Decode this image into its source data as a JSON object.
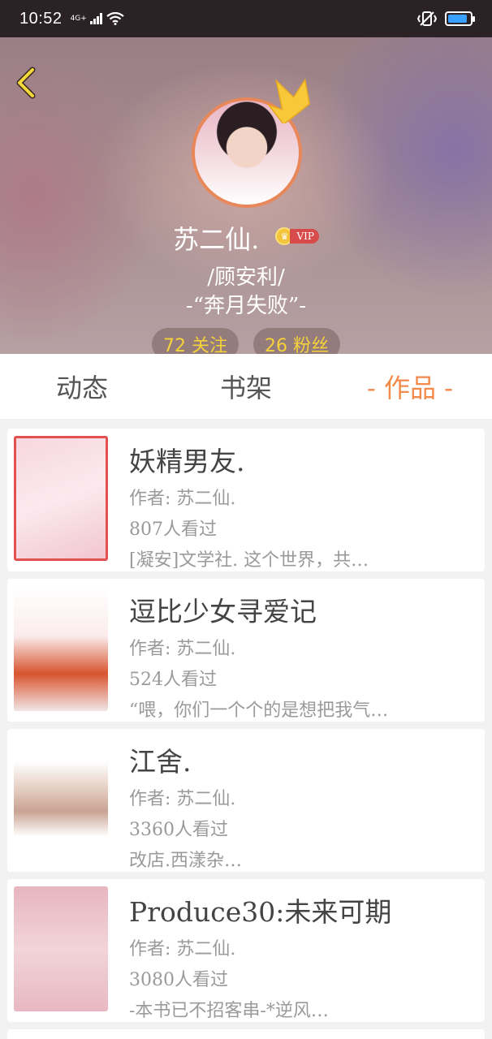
{
  "status_bar": {
    "time": "10:52",
    "network": "4G+",
    "battery_level": 0.9
  },
  "profile": {
    "username": "苏二仙.",
    "vip_label": "VIP",
    "bio_line1": "/顾安利/",
    "bio_line2": "-“奔月失败”-",
    "following": "72 关注",
    "followers": "26 粉丝"
  },
  "tabs": [
    {
      "label": "动态"
    },
    {
      "label": "书架"
    },
    {
      "label": "- 作品 -"
    }
  ],
  "works": [
    {
      "title": "妖精男友.",
      "author": "作者: 苏二仙.",
      "views": "807人看过",
      "summary": "[凝安]文学社. 这个世界，共…"
    },
    {
      "title": "逗比少女寻爱记",
      "author": "作者: 苏二仙.",
      "views": "524人看过",
      "summary": "“喂，你们一个个的是想把我气…"
    },
    {
      "title": "江舍.",
      "author": "作者: 苏二仙.",
      "views": "3360人看过",
      "summary": "改店.西漾杂…"
    },
    {
      "title": "Produce30:未来可期",
      "author": "作者: 苏二仙.",
      "views": "3080人看过",
      "summary": "-本书已不招客串-*逆风…"
    }
  ],
  "colors": {
    "accent": "#f28a4b",
    "stat_text": "#f5d23a",
    "avatar_ring": "#e8885a"
  },
  "icons": {
    "back": "chevron-left-icon",
    "crown": "crown-icon"
  }
}
